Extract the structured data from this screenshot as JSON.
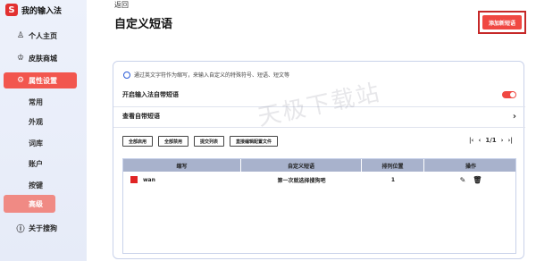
{
  "sidebar": {
    "brand": {
      "logo": "S",
      "title": "我的输入法"
    },
    "items": [
      {
        "icon": "user-icon",
        "glyph": "♙",
        "label": "个人主页"
      },
      {
        "icon": "shirt-icon",
        "glyph": "♔",
        "label": "皮肤商城"
      },
      {
        "icon": "gear-icon",
        "glyph": "⚙",
        "label": "属性设置"
      },
      {
        "icon": "info-icon",
        "glyph": "ⓘ",
        "label": "关于搜狗"
      }
    ],
    "sub_items": [
      "常用",
      "外观",
      "词库",
      "账户",
      "按键",
      "高级"
    ],
    "active_item": "属性设置",
    "selected_sub": "高级"
  },
  "main": {
    "back_label": "返回",
    "title": "自定义短语",
    "add_button": "添加新短语",
    "tip": "通过英文字符作为缩写，来输入自定义的特殊符号、短语、短文等",
    "enable_label": "开启输入法自带短语",
    "view_label": "查看自带短语",
    "buttons": [
      "全部启用",
      "全部禁用",
      "提交列表",
      "直接编辑配置文件"
    ],
    "pager": {
      "first": "|‹",
      "prev": "‹",
      "page": "1/1",
      "next": "›",
      "last": "›|"
    },
    "table": {
      "headers": [
        "缩写",
        "自定义短语",
        "排列位置",
        "操作"
      ],
      "rows": [
        {
          "abbr": "wan",
          "phrase": "第一次就选择搜狗吧",
          "position": "1"
        }
      ]
    }
  },
  "watermark": "天极下载站",
  "colors": {
    "accent": "#f04842",
    "sidebar_bg": "#e6ebf8",
    "table_header": "#a8b2cc"
  }
}
